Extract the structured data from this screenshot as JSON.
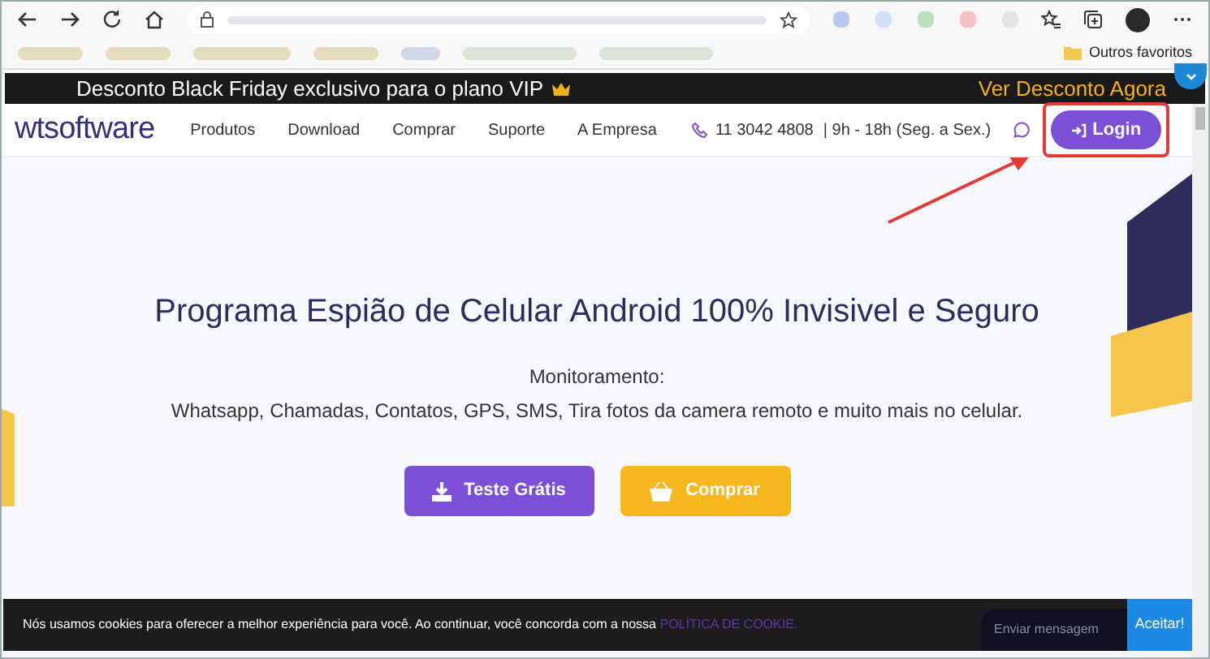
{
  "browser": {
    "bookmarks_other": "Outros favoritos"
  },
  "promo": {
    "text": "Desconto Black Friday exclusivo para o plano VIP",
    "link": "Ver Desconto Agora"
  },
  "nav": {
    "logo": "wtsoftware",
    "items": [
      "Produtos",
      "Download",
      "Comprar",
      "Suporte",
      "A Empresa"
    ],
    "phone": "11 3042 4808",
    "hours": "| 9h - 18h (Seg. a Sex.)",
    "login": "Login"
  },
  "hero": {
    "title": "Programa Espião de Celular Android 100% Invisivel e Seguro",
    "subtitle": "Monitoramento:",
    "features": "Whatsapp, Chamadas, Contatos, GPS, SMS, Tira fotos da camera remoto e muito mais no celular.",
    "buttons": [
      {
        "kind": "download",
        "label": "Teste Grátis"
      },
      {
        "kind": "buy",
        "label": "Comprar"
      }
    ]
  },
  "cookie": {
    "text": "Nós usamos cookies para oferecer a melhor experiência para você. Ao continuar, você concorda com a nossa",
    "link": "POLÍTICA DE COOKIE.",
    "accept": "Aceitar!"
  },
  "chat": {
    "placeholder": "Enviar mensagem"
  }
}
